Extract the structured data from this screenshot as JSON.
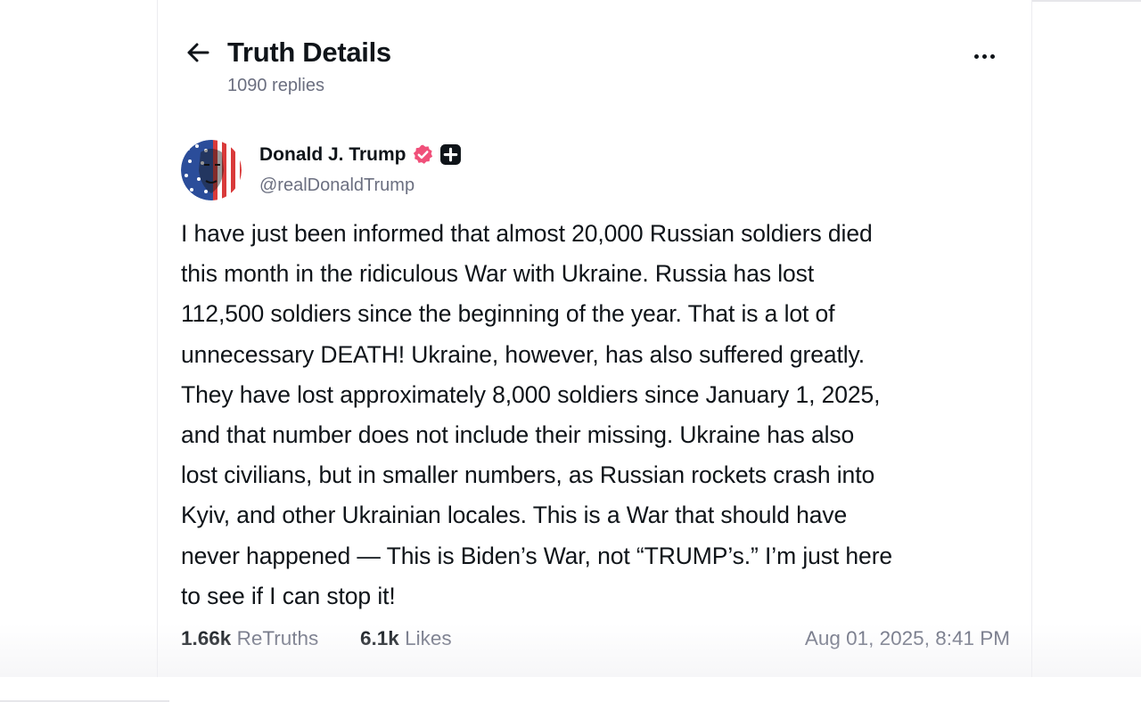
{
  "header": {
    "title": "Truth Details",
    "replies": "1090 replies",
    "back_icon": "arrow-left-icon",
    "more_icon": "more-horizontal-icon"
  },
  "author": {
    "name": "Donald J. Trump",
    "handle": "@realDonaldTrump",
    "verified_icon": "verified-badge-icon",
    "plus_icon": "plus-badge-icon",
    "verified_color": "#f0507a"
  },
  "post": {
    "lines": [
      "I have just been informed that almost 20,000 Russian soldiers died",
      "this month in the ridiculous War with Ukraine. Russia has lost",
      "112,500 soldiers since the beginning of the year. That is a lot of",
      "unnecessary DEATH! Ukraine, however, has also suffered greatly.",
      "They have lost approximately 8,000 soldiers since January 1, 2025,",
      "and that number does not include their missing. Ukraine has also",
      "lost civilians, but in smaller numbers, as Russian rockets crash into",
      "Kyiv, and other Ukrainian locales. This is a War that should have",
      "never happened — This is Biden’s War, not “TRUMP’s.” I’m just here",
      "to see if I can stop it!"
    ]
  },
  "stats": {
    "retruths_count": "1.66k",
    "retruths_label": "ReTruths",
    "likes_count": "6.1k",
    "likes_label": "Likes",
    "timestamp": "Aug 01, 2025, 8:41 PM"
  }
}
